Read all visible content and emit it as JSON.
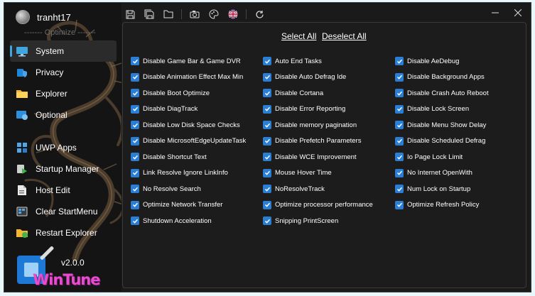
{
  "user": {
    "name": "tranht17"
  },
  "sidebar": {
    "section_label": "------- Optimize -------",
    "items": [
      {
        "label": "System",
        "active": true,
        "icon": "monitor-icon"
      },
      {
        "label": "Privacy",
        "icon": "privacy-icon"
      },
      {
        "label": "Explorer",
        "icon": "folder-icon"
      },
      {
        "label": "Optional",
        "icon": "optional-icon"
      },
      {
        "label": "UWP Apps",
        "icon": "apps-grid-icon"
      },
      {
        "label": "Startup Manager",
        "icon": "startup-icon"
      },
      {
        "label": "Host Edit",
        "icon": "host-file-icon"
      },
      {
        "label": "Clear StartMenu",
        "icon": "start-menu-icon"
      },
      {
        "label": "Restart Explorer",
        "icon": "restart-explorer-icon"
      }
    ]
  },
  "brand": {
    "version": "v2.0.0",
    "logo_text": "WinTune"
  },
  "toolbar": {
    "icons": [
      "save-icon",
      "save-all-icon",
      "open-folder-icon",
      "camera-icon",
      "palette-icon",
      "uk-flag-icon",
      "refresh-icon"
    ]
  },
  "actions": {
    "select_all": "Select All",
    "deselect_all": "Deselect All"
  },
  "options": {
    "col1": [
      "Disable Game Bar & Game DVR",
      "Disable Animation Effect Max Min",
      "Disable Boot Optimize",
      "Disable DiagTrack",
      "Disable Low Disk Space Checks",
      "Disable MicrosoftEdgeUpdateTask",
      "Disable Shortcut Text",
      "Link Resolve Ignore LinkInfo",
      "No Resolve Search",
      "Optimize Network Transfer",
      "Shutdown Acceleration"
    ],
    "col2": [
      "Auto End Tasks",
      "Disable Auto Defrag Ide",
      "Disable Cortana",
      "Disable Error Reporting",
      "Disable memory pagination",
      "Disable Prefetch Parameters",
      "Disable WCE Improvement",
      "Mouse Hover Time",
      "NoResolveTrack",
      "Optimize processor performance",
      "Snipping PrintScreen"
    ],
    "col3": [
      "Disable AeDebug",
      "Disable Background Apps",
      "Disable Crash Auto Reboot",
      "Disable Lock Screen",
      "Disable Menu Show Delay",
      "Disable Scheduled Defrag",
      "Io Page Lock Limit",
      "No Internet OpenWith",
      "Num Lock on Startup",
      "Optimize Refresh Policy"
    ]
  },
  "colors": {
    "accent": "#2a7fd4",
    "background": "#1a1a1a",
    "sidebar": "#141414",
    "logo_text": "#e84bd0"
  }
}
